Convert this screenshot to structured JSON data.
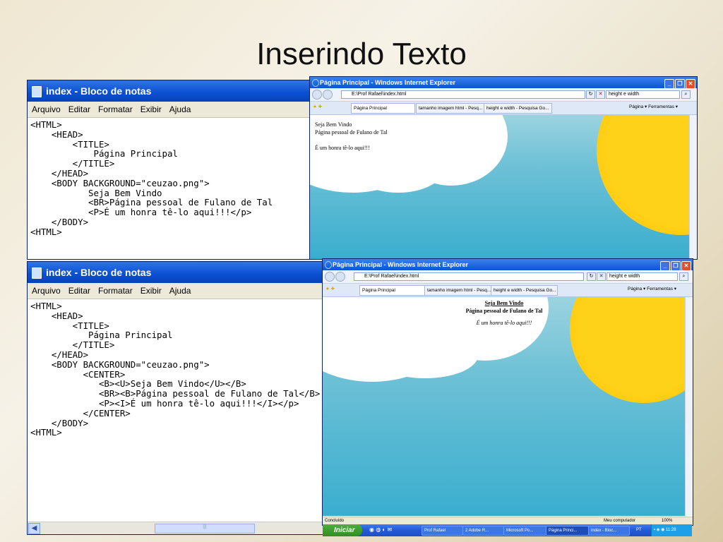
{
  "slide": {
    "title": "Inserindo Texto"
  },
  "notepad_top": {
    "title": "index - Bloco de notas",
    "menu": [
      "Arquivo",
      "Editar",
      "Formatar",
      "Exibir",
      "Ajuda"
    ],
    "code": "<HTML>\n    <HEAD>\n        <TITLE>\n            Página Principal\n        </TITLE>\n    </HEAD>\n    <BODY BACKGROUND=\"ceuzao.png\">\n           Seja Bem Vindo\n           <BR>Página pessoal de Fulano de Tal\n           <P>É um honra tê-lo aqui!!!</p>\n    </BODY>\n<HTML>"
  },
  "notepad_bottom": {
    "title": "index - Bloco de notas",
    "menu": [
      "Arquivo",
      "Editar",
      "Formatar",
      "Exibir",
      "Ajuda"
    ],
    "code": "<HTML>\n    <HEAD>\n        <TITLE>\n           Página Principal\n        </TITLE>\n    </HEAD>\n    <BODY BACKGROUND=\"ceuzao.png\">\n          <CENTER>\n             <B><U>Seja Bem Vindo</U></B>\n             <BR><B>Página pessoal de Fulano de Tal</B>\n             <P><I>É um honra tê-lo aqui!!!</I></p>\n          </CENTER>\n    </BODY>\n<HTML>"
  },
  "browser_top": {
    "title": "Página Principal - Windows Internet Explorer",
    "address": "E:\\Prof Rafael\\index.html",
    "search": "height e width",
    "tabs": [
      "Página Principal",
      "tamanho imagem html - Pesq...",
      "height e width - Pesquisa Go..."
    ],
    "tools": "Página ▾  Ferramentas ▾",
    "page": {
      "line1": "Seja Bem Vindo",
      "line2": "Página pessoal de Fulano de Tal",
      "line3": "É um honra tê-lo aqui!!!"
    }
  },
  "browser_bottom": {
    "title": "Página Principal - Windows Internet Explorer",
    "address": "E:\\Prof Rafael\\index.html",
    "search": "height e width",
    "tabs": [
      "Página Principal",
      "tamanho imagem html - Pesq...",
      "height e width - Pesquisa Go..."
    ],
    "tools": "Página ▾  Ferramentas ▾",
    "page": {
      "line1": "Seja Bem Vindo",
      "line2": "Página pessoal de Fulano de Tal",
      "line3": "É um honra tê-lo aqui!!!"
    },
    "status": {
      "left": "Concluído",
      "zone": "Meu computador",
      "zoom": "100%"
    }
  },
  "taskbar": {
    "start": "Iniciar",
    "tasks": [
      "Prof Rafael",
      "2 Adobe R...",
      "Microsoft Po...",
      "Página Princi...",
      "index - Bloc..."
    ],
    "lang": "PT",
    "clock": "11:28"
  },
  "colors": {
    "titlebar": "#0b55d4",
    "sky": "#3aaecf",
    "sun": "#ffd21a"
  }
}
